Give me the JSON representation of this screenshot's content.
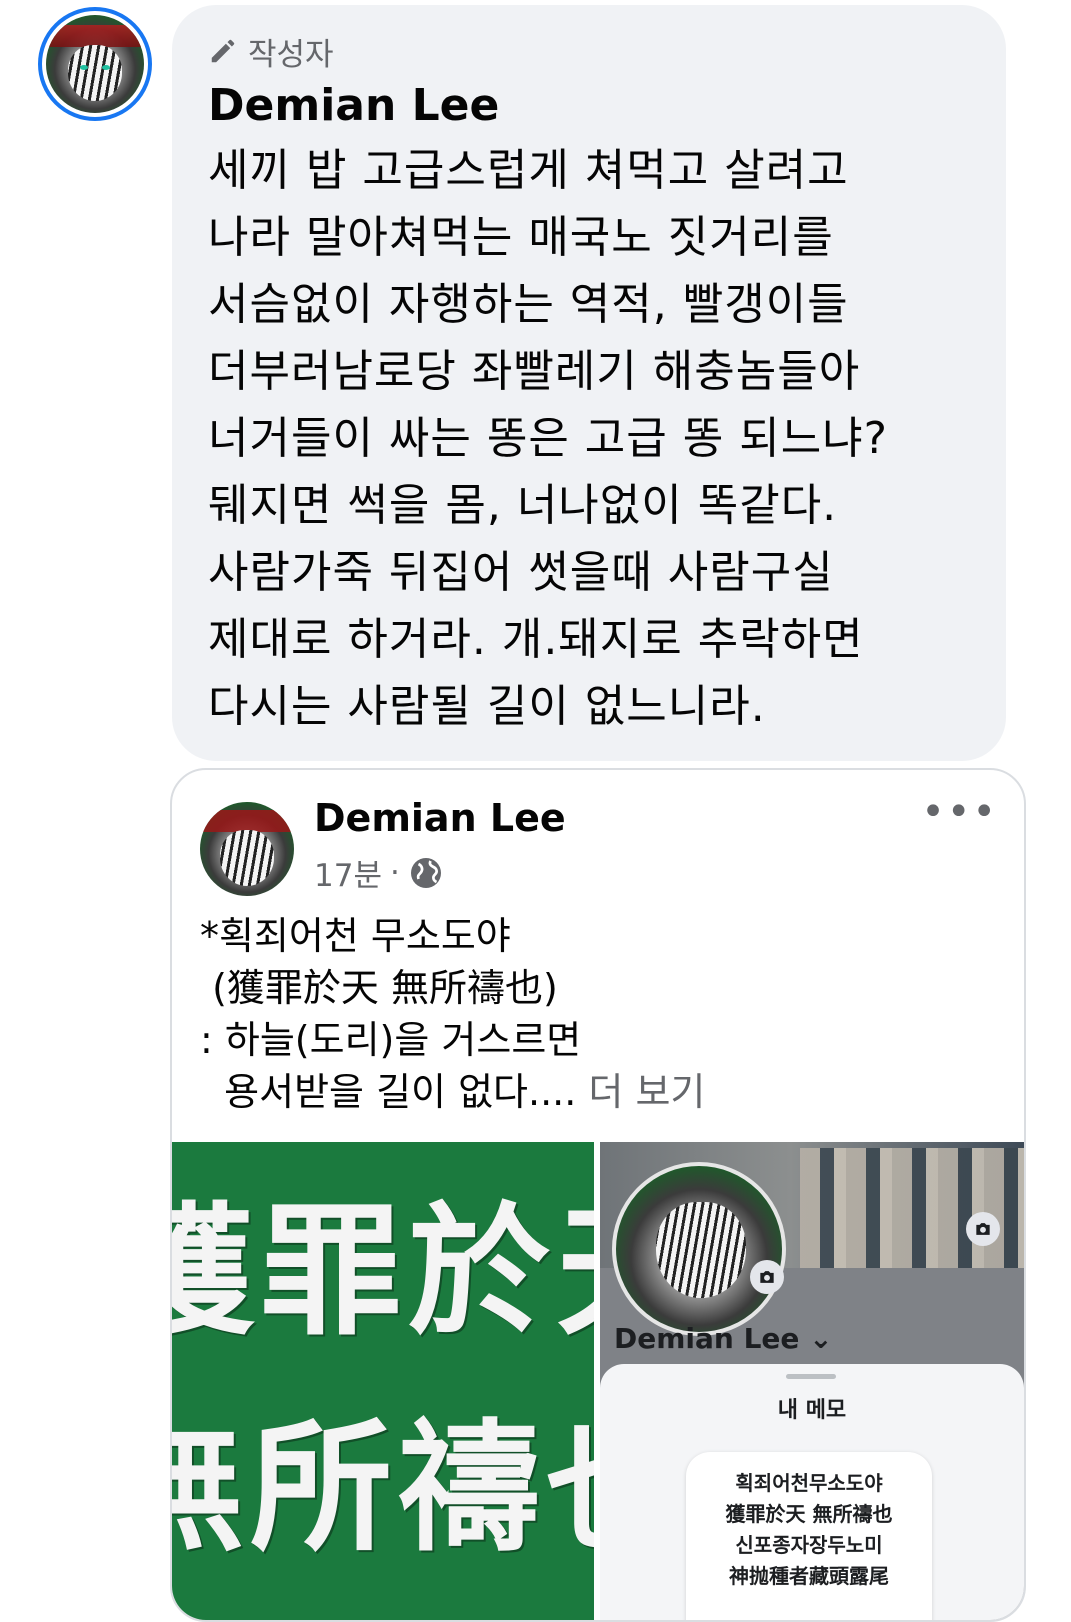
{
  "comment": {
    "author_badge": "작성자",
    "author_name": "Demian Lee",
    "text": "세끼 밥 고급스럽게 쳐먹고 살려고\n나라 말아쳐먹는 매국노 짓거리를\n서슴없이 자행하는 역적, 빨갱이들\n더부러남로당 좌빨레기 해충놈들아\n너거들이 싸는 똥은 고급 똥 되느냐?\n뒈지면 썩을 몸, 너나없이 똑같다.\n사람가죽 뒤집어 썻을때 사람구실\n제대로 하거라. 개.돼지로 추락하면\n다시는 사람될 길이 없느니라."
  },
  "post": {
    "author_name": "Demian Lee",
    "time": "17분",
    "separator": "·",
    "text": "*획죄어천 무소도야\n (獲罪於天 無所禱也)\n: 하늘(도리)을 거스르면\n  용서받을 길이 없다....",
    "see_more": " 더 보기",
    "image_left": {
      "line1": "獲罪於天",
      "line2": "無所禱也"
    },
    "image_right": {
      "profile_name": "Demian Lee ⌄",
      "sheet_title": "내 메모",
      "note_lines": [
        "획죄어천무소도야",
        "獲罪於天 無所禱也",
        "신포종자장두노미",
        "神抛種者藏頭露尾"
      ]
    }
  },
  "icons": {
    "pencil": "pencil-icon",
    "globe": "globe-icon",
    "more": "more-icon",
    "camera": "camera-icon"
  }
}
